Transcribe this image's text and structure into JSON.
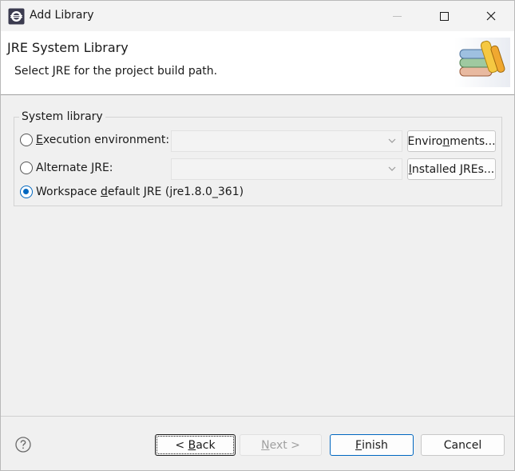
{
  "window": {
    "title": "Add Library"
  },
  "banner": {
    "title": "JRE System Library",
    "description": "Select JRE for the project build path."
  },
  "group": {
    "legend": "System library",
    "options": [
      {
        "pre": "",
        "mnemonic": "E",
        "post": "xecution environment:",
        "selected": false
      },
      {
        "pre": "Alternate ",
        "mnemonic": "J",
        "post": "RE:",
        "selected": false
      },
      {
        "pre": "Workspace ",
        "mnemonic": "d",
        "post": "efault JRE (jre1.8.0_361)",
        "selected": true
      }
    ],
    "execution_env_value": "",
    "alternate_jre_value": "",
    "environments_button": {
      "pre": "Enviro",
      "mnemonic": "n",
      "post": "ments..."
    },
    "installed_jres_button": {
      "pre": "",
      "mnemonic": "I",
      "post": "nstalled JREs..."
    }
  },
  "footer": {
    "back": {
      "pre": "< ",
      "mnemonic": "B",
      "post": "ack"
    },
    "next": {
      "pre": "",
      "mnemonic": "N",
      "post": "ext >",
      "enabled": false
    },
    "finish": {
      "pre": "",
      "mnemonic": "F",
      "post": "inish"
    },
    "cancel": "Cancel"
  },
  "colors": {
    "accent": "#0067c0",
    "disabled_text": "#a0a0a0"
  },
  "icons": [
    "eclipse-app-icon",
    "minimize-icon",
    "maximize-icon",
    "close-icon",
    "library-books-icon",
    "dropdown-arrow-icon",
    "help-icon"
  ]
}
